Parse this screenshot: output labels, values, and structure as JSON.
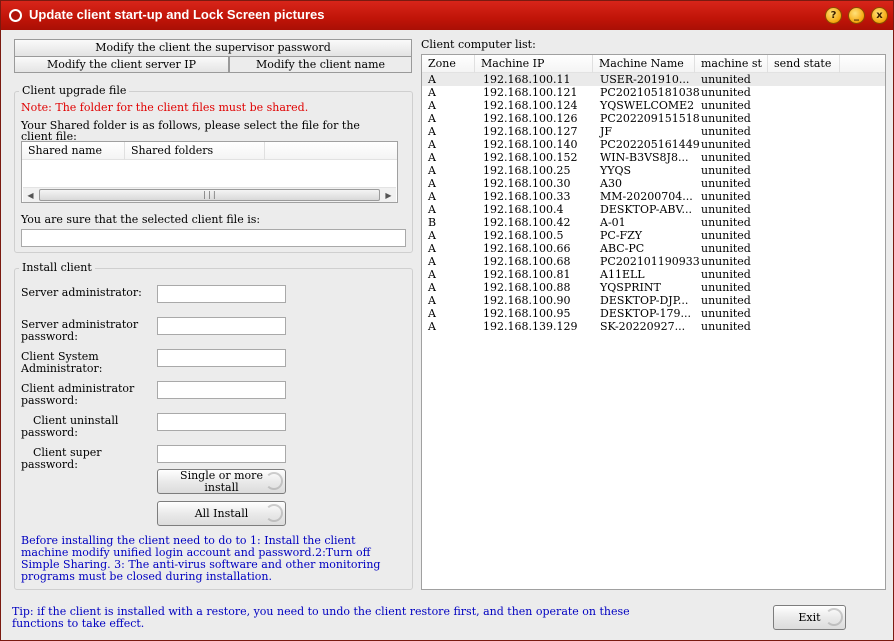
{
  "window": {
    "title": "Update client start-up and Lock Screen pictures",
    "buttons": {
      "help": "?",
      "minimize": "_",
      "close": "x"
    }
  },
  "tabs": [
    {
      "label": "Modify the client the supervisor password"
    },
    {
      "label": "Modify the client server IP"
    },
    {
      "label": "Modify the client name"
    }
  ],
  "upgrade": {
    "group_title": "Client upgrade file",
    "note": "Note: The folder for the client files must be shared.",
    "instruction_line1": "Your Shared folder is as follows, please select the file for the",
    "instruction_line2": "client file:",
    "columns": [
      "Shared name",
      "Shared folders"
    ],
    "selected_label": "You are sure that the selected client file is:",
    "selected_value": ""
  },
  "install": {
    "group_title": "Install client",
    "fields": [
      {
        "label1": "Server administrator:",
        "label2": "",
        "value": ""
      },
      {
        "label1": "Server administrator",
        "label2": "password:",
        "value": ""
      },
      {
        "label1": "Client System",
        "label2": "Administrator:",
        "value": ""
      },
      {
        "label1": "Client administrator",
        "label2": "password:",
        "value": ""
      },
      {
        "label1": "Client uninstall",
        "label2": "password:",
        "value": ""
      },
      {
        "label1": "Client super",
        "label2": "password:",
        "value": ""
      }
    ],
    "single_button_line1": "Single or more",
    "single_button_line2": "install",
    "all_button": "All Install",
    "note_line1": "Before installing the client need to do to 1: Install the client",
    "note_line2": "machine modify unified login account and password.2:Turn off",
    "note_line3": "Simple Sharing. 3: The anti-virus software and other monitoring",
    "note_line4": "programs must be closed during installation."
  },
  "client_list": {
    "title": "Client computer list:",
    "columns": [
      "Zone",
      "Machine IP",
      "Machine Name",
      "machine st",
      "send state"
    ],
    "rows": [
      {
        "zone": "A",
        "ip": "192.168.100.11",
        "name": "USER-201910...",
        "state": "ununited",
        "send": ""
      },
      {
        "zone": "A",
        "ip": "192.168.100.121",
        "name": "PC202105181038",
        "state": "ununited",
        "send": ""
      },
      {
        "zone": "A",
        "ip": "192.168.100.124",
        "name": "YQSWELCOME2",
        "state": "ununited",
        "send": ""
      },
      {
        "zone": "A",
        "ip": "192.168.100.126",
        "name": "PC202209151518",
        "state": "ununited",
        "send": ""
      },
      {
        "zone": "A",
        "ip": "192.168.100.127",
        "name": "JF",
        "state": "ununited",
        "send": ""
      },
      {
        "zone": "A",
        "ip": "192.168.100.140",
        "name": "PC202205161449",
        "state": "ununited",
        "send": ""
      },
      {
        "zone": "A",
        "ip": "192.168.100.152",
        "name": "WIN-B3VS8J8...",
        "state": "ununited",
        "send": ""
      },
      {
        "zone": "A",
        "ip": "192.168.100.25",
        "name": "YYQS",
        "state": "ununited",
        "send": ""
      },
      {
        "zone": "A",
        "ip": "192.168.100.30",
        "name": "A30",
        "state": "ununited",
        "send": ""
      },
      {
        "zone": "A",
        "ip": "192.168.100.33",
        "name": "MM-20200704...",
        "state": "ununited",
        "send": ""
      },
      {
        "zone": "A",
        "ip": "192.168.100.4",
        "name": "DESKTOP-ABV...",
        "state": "ununited",
        "send": ""
      },
      {
        "zone": "B",
        "ip": "192.168.100.42",
        "name": "A-01",
        "state": "ununited",
        "send": ""
      },
      {
        "zone": "A",
        "ip": "192.168.100.5",
        "name": "PC-FZY",
        "state": "ununited",
        "send": ""
      },
      {
        "zone": "A",
        "ip": "192.168.100.66",
        "name": "ABC-PC",
        "state": "ununited",
        "send": ""
      },
      {
        "zone": "A",
        "ip": "192.168.100.68",
        "name": "PC202101190933",
        "state": "ununited",
        "send": ""
      },
      {
        "zone": "A",
        "ip": "192.168.100.81",
        "name": "A11ELL",
        "state": "ununited",
        "send": ""
      },
      {
        "zone": "A",
        "ip": "192.168.100.88",
        "name": "YQSPRINT",
        "state": "ununited",
        "send": ""
      },
      {
        "zone": "A",
        "ip": "192.168.100.90",
        "name": "DESKTOP-DJP...",
        "state": "ununited",
        "send": ""
      },
      {
        "zone": "A",
        "ip": "192.168.100.95",
        "name": "DESKTOP-179...",
        "state": "ununited",
        "send": ""
      },
      {
        "zone": "A",
        "ip": "192.168.139.129",
        "name": "SK-20220927...",
        "state": "ununited",
        "send": ""
      }
    ]
  },
  "footer": {
    "tip_line1": "Tip: if the client is installed with a restore, you need to undo the client restore first, and then operate on these",
    "tip_line2": "functions to take effect.",
    "exit_button": "Exit"
  },
  "colors": {
    "title_bar": "#c01408",
    "note_red": "#e00000",
    "note_blue": "#0000c0"
  }
}
